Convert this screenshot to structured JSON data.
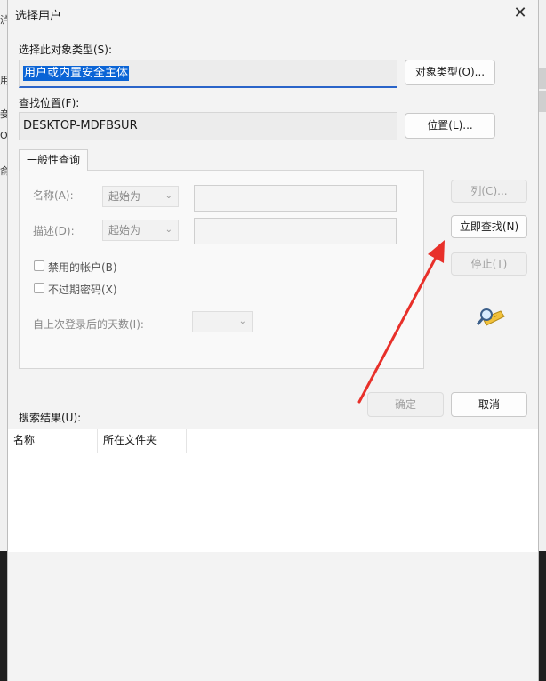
{
  "dialog": {
    "title": "选择用户",
    "close_glyph": "✕",
    "object_type_label": "选择此对象类型(S):",
    "object_type_value": "用户或内置安全主体",
    "object_type_button": "对象类型(O)...",
    "location_label": "查找位置(F):",
    "location_value": "DESKTOP-MDFBSUR",
    "location_button": "位置(L)..."
  },
  "query": {
    "tab_label": "一般性查询",
    "name_label": "名称(A):",
    "name_mode": "起始为",
    "desc_label": "描述(D):",
    "desc_mode": "起始为",
    "disabled_accounts_label": "禁用的帐户(B)",
    "non_expiring_label": "不过期密码(X)",
    "days_label": "自上次登录后的天数(I):"
  },
  "actions": {
    "columns_button": "列(C)...",
    "find_now_button": "立即查找(N)",
    "stop_button": "停止(T)",
    "ok_button": "确定",
    "cancel_button": "取消"
  },
  "results": {
    "label": "搜索结果(U):",
    "columns": [
      "名称",
      "所在文件夹"
    ]
  },
  "background": {
    "left_fragments": [
      "泸",
      "用",
      "妾",
      "O",
      "俞"
    ]
  },
  "icons": {
    "search": "magnifier-icon",
    "annotation": "red-arrow"
  },
  "colors": {
    "accent": "#0a64d6",
    "arrow": "#e8302a"
  }
}
